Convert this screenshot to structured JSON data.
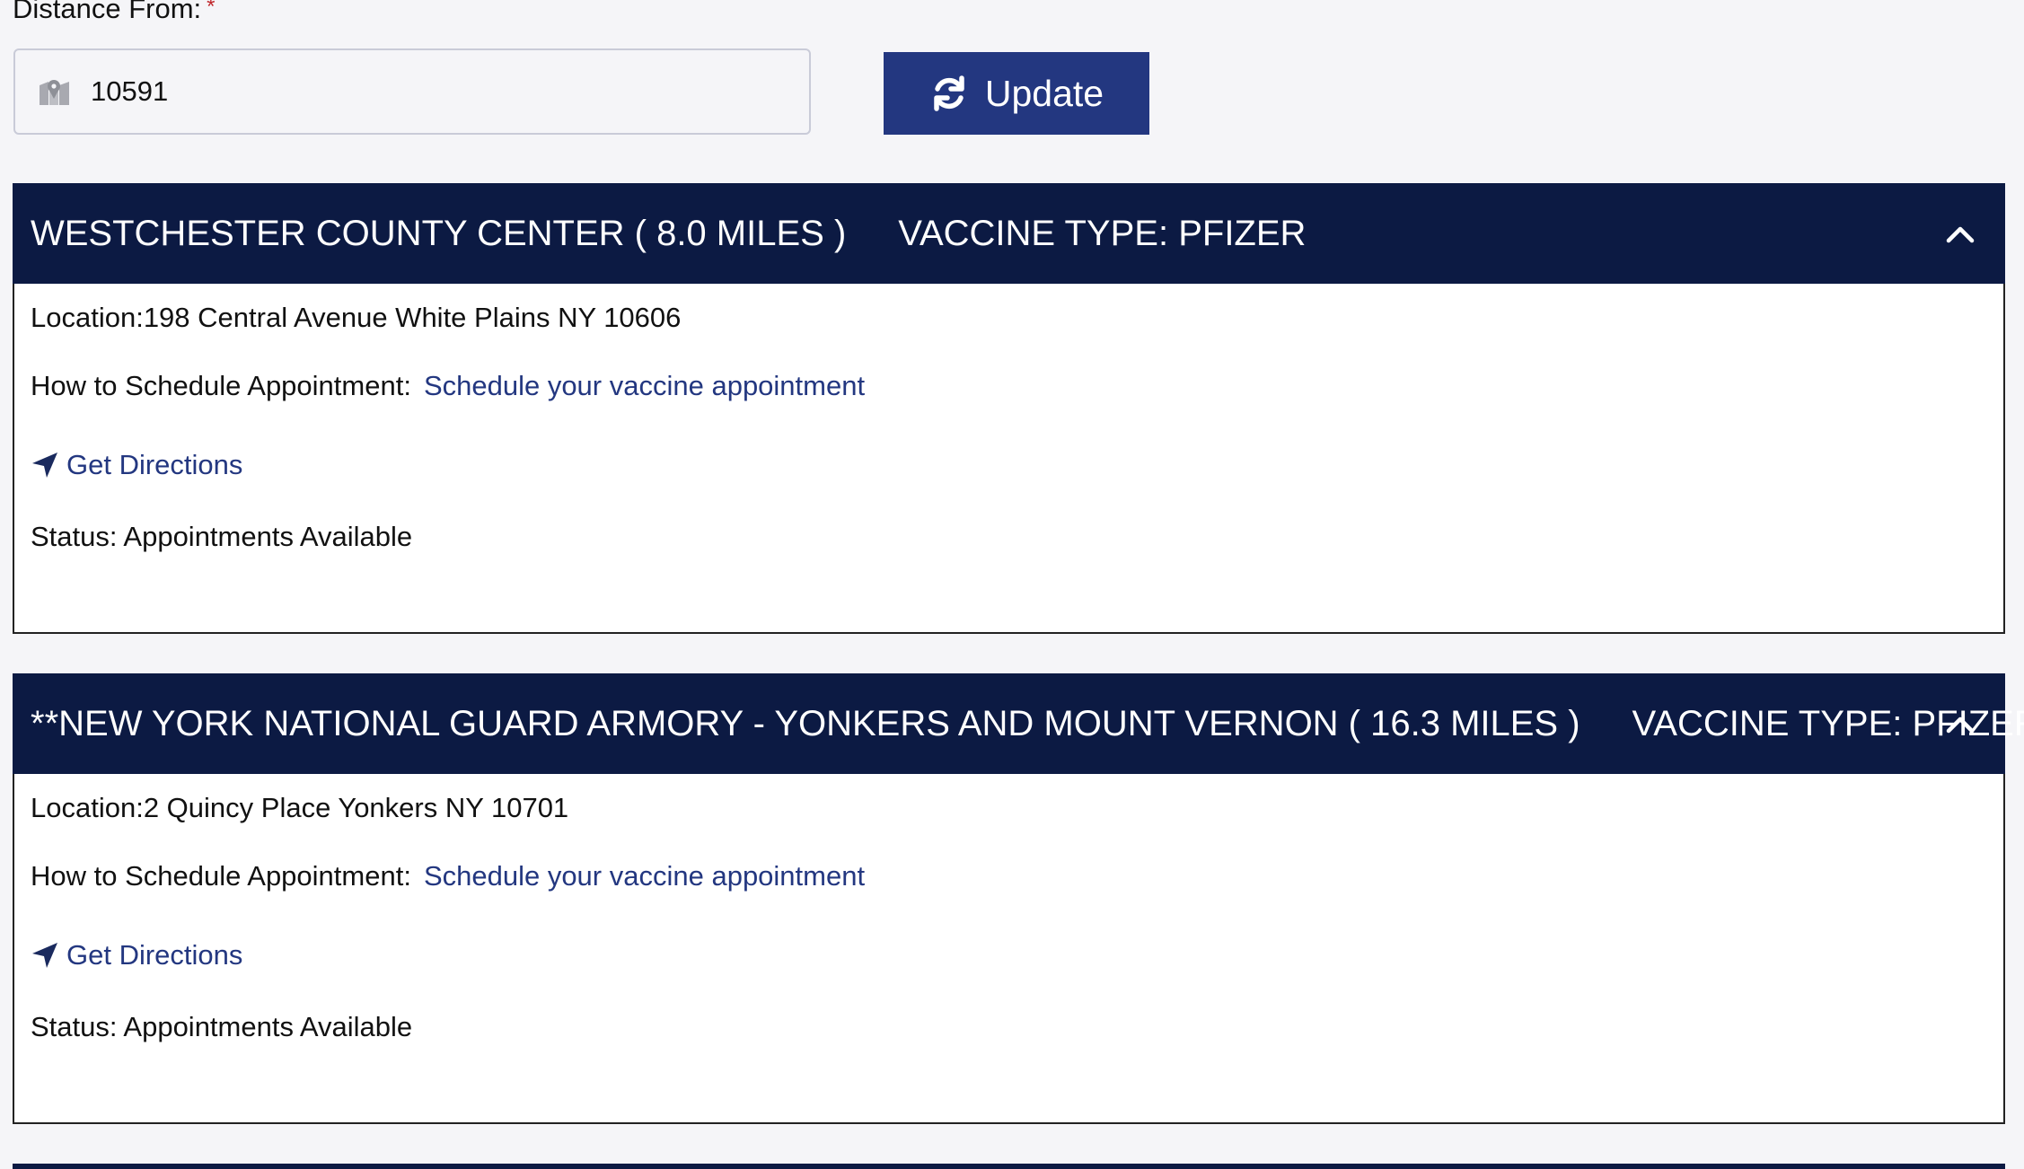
{
  "form": {
    "distance_label": "Distance From:",
    "required_mark": "*",
    "zip_value": "10591",
    "update_label": "Update"
  },
  "sites": [
    {
      "name": "WESTCHESTER COUNTY CENTER ( 8.0 MILES )",
      "vaccine_type": "VACCINE TYPE: PFIZER",
      "location": "Location:198 Central Avenue White Plains NY 10606",
      "schedule_label": "How to Schedule Appointment:",
      "schedule_link": "Schedule your vaccine appointment",
      "directions": "Get Directions",
      "status_label": "Status:",
      "status_value": "Appointments Available"
    },
    {
      "name": "**NEW YORK NATIONAL GUARD ARMORY - YONKERS AND MOUNT VERNON ( 16.3 MILES )",
      "vaccine_type": "VACCINE TYPE: PFIZER",
      "location": "Location:2 Quincy Place Yonkers NY 10701",
      "schedule_label": "How to Schedule Appointment:",
      "schedule_link": "Schedule your vaccine appointment",
      "directions": "Get Directions",
      "status_label": "Status:",
      "status_value": "Appointments Available"
    }
  ],
  "icons": {
    "zip": "map-icon",
    "update": "refresh-icon",
    "collapse": "chevron-up-icon",
    "directions": "navigation-arrow-icon"
  },
  "colors": {
    "header_bg": "#0c1a43",
    "button_bg": "#233780",
    "link": "#233780",
    "required": "#c0282d"
  }
}
